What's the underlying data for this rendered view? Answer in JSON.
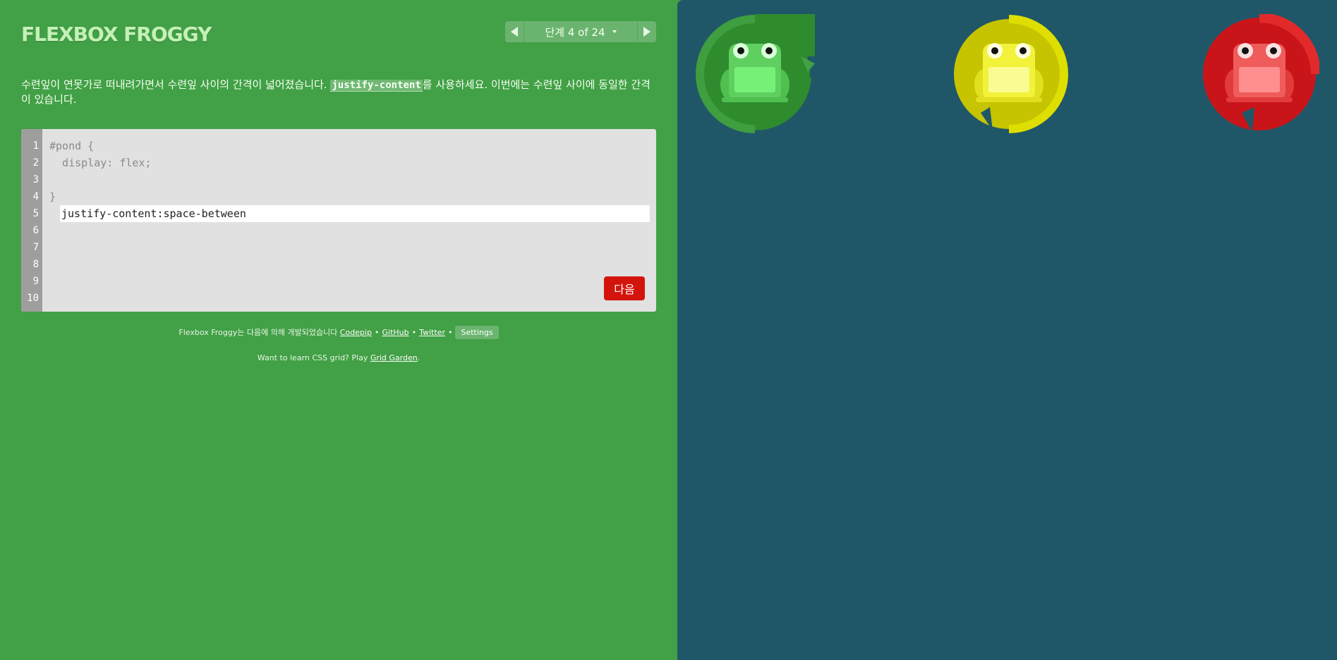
{
  "app": {
    "logo": "FLEXBOX FROGGY"
  },
  "level_nav": {
    "label": "단계 4 of 24",
    "prev_icon": "triangle-left-icon",
    "next_icon": "triangle-right-icon",
    "dropdown_icon": "caret-down-icon"
  },
  "instructions": {
    "before": "수련잎이 연못가로 떠내려가면서 수련잎 사이의 간격이 넓어졌습니다. ",
    "code": "justify-content",
    "after": "를 사용하세요. 이번에는 수련잎 사이에 동일한 간격이 있습니다."
  },
  "editor": {
    "line_numbers": [
      "1",
      "2",
      "3",
      "4",
      "5",
      "6",
      "7",
      "8",
      "9",
      "10"
    ],
    "line1": "#pond {",
    "line2": "  display: flex;",
    "input_value": "justify-content:space-between",
    "line4": "}",
    "next_label": "다음"
  },
  "credits": {
    "prefix": "Flexbox Froggy는 다음에 의해 개발되었습니다 ",
    "codepip": "Codepip",
    "github": "GitHub",
    "twitter": "Twitter",
    "bullet": "•",
    "settings": "Settings"
  },
  "promo": {
    "prefix": "Want to learn CSS grid? Play ",
    "link": "Grid Garden",
    "suffix": "."
  },
  "pond": {
    "frogs": [
      {
        "color": "green",
        "pad": "#2e8b2e",
        "pad_rim": "#3f9e3f",
        "body": "#5fcf5f",
        "belly": "#77f077"
      },
      {
        "color": "yellow",
        "pad": "#c6c300",
        "pad_rim": "#dede00",
        "body": "#f2f23a",
        "belly": "#fbfb93"
      },
      {
        "color": "red",
        "pad": "#c9151a",
        "pad_rim": "#e32a2a",
        "body": "#f05b5b",
        "belly": "#ff8f8f"
      }
    ],
    "background": "#1f5768"
  },
  "colors": {
    "sidebar": "#42a046",
    "next_button": "#d3140c",
    "editor_bg": "#e1e1e1"
  }
}
